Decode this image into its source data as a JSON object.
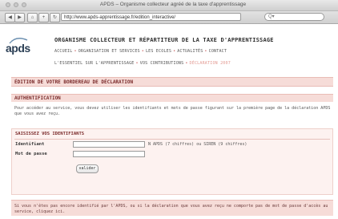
{
  "window": {
    "title": "APDS – Organisme collecteur agréé de la taxe d'apprentissage"
  },
  "toolbar": {
    "back": "◀",
    "forward": "▶",
    "home": "⌂",
    "add": "+",
    "reload": "↻",
    "url": "http://www.apds-apprentissage.fr/edition_interactive/",
    "search_placeholder": "Q▾"
  },
  "header": {
    "logo": "apds",
    "org_title": "ORGANISME COLLECTEUR ET RÉPARTITEUR DE LA TAXE D'APPRENTISSAGE",
    "nav_primary": [
      "ACCUEIL",
      "ORGANISATION ET SERVICES",
      "LES ECOLES",
      "ACTUALITÉS",
      "CONTACT"
    ],
    "nav_secondary": [
      "L'ESSENTIEL SUR L'APPRENTISSAGE",
      "VOS CONTRIBUTIONS",
      "DÉCLARATION 2007"
    ]
  },
  "main": {
    "edition_title": "ÉDITION DE VOTRE BORDEREAU DE DÉCLARATION",
    "auth_title": "AUTHENTIFICATION",
    "auth_text": "Pour accéder au service, vous devez utiliser les identifiants et mots de passe figurant sur la première page de la déclaration APDS que vous avez reçu.",
    "form_title": "SAISISSEZ VOS IDENTIFIANTS",
    "identifier_label": "Identifiant",
    "password_label": "Mot de passe",
    "identifier_hint": "N APDS (7 chiffres) ou SIREN (9 chiffres)",
    "submit_label": "valider",
    "footer_note": "Si vous n'êtes pas encore identifié par l'APDS, ou si la déclaration que vous avez reçu ne comporte pas de mot de passe d'accès au service, cliquez ici."
  }
}
